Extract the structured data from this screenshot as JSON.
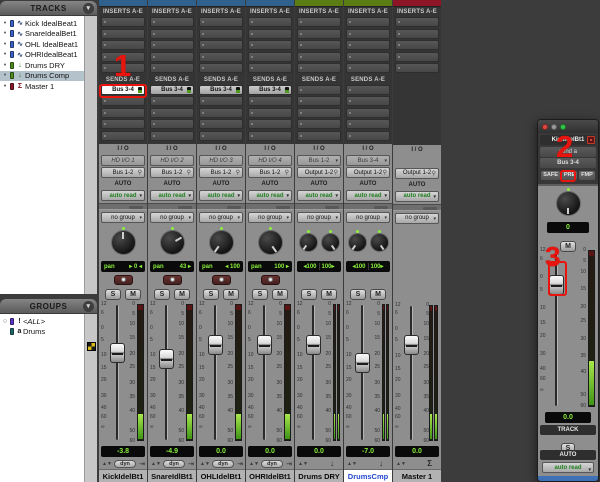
{
  "tracks_panel": {
    "title": "TRACKS",
    "tracks": [
      {
        "name": "Kick IdealBeat1",
        "chip": "#3a62c8",
        "type_icon": "waveform",
        "glyph": "∿",
        "icon_color": "#23406e",
        "selected": false
      },
      {
        "name": "SnareIdealBet1",
        "chip": "#3a62c8",
        "type_icon": "waveform",
        "glyph": "∿",
        "icon_color": "#23406e",
        "selected": false
      },
      {
        "name": "OHL IdealBeat1",
        "chip": "#3a62c8",
        "type_icon": "waveform",
        "glyph": "∿",
        "icon_color": "#23406e",
        "selected": false
      },
      {
        "name": "OHRIdealBeat1",
        "chip": "#3a62c8",
        "type_icon": "waveform",
        "glyph": "∿",
        "icon_color": "#23406e",
        "selected": false
      },
      {
        "name": "Drums DRY",
        "chip": "#4e8a1e",
        "type_icon": "aux-arrow",
        "glyph": "↓",
        "icon_color": "#2e6a10",
        "selected": false
      },
      {
        "name": "Drums Comp",
        "chip": "#4e8a1e",
        "type_icon": "aux-arrow",
        "glyph": "↓",
        "icon_color": "#2e6a10",
        "selected": true
      },
      {
        "name": "Master 1",
        "chip": "#8a1a28",
        "type_icon": "sigma",
        "glyph": "Σ",
        "icon_color": "#7a1220",
        "selected": false
      }
    ]
  },
  "groups_panel": {
    "title": "GROUPS",
    "groups": [
      {
        "mark": "○",
        "chip": "#5a35c8",
        "id": "!",
        "name": "<ALL>"
      },
      {
        "mark": "",
        "chip": "#1e6a6a",
        "id": "a",
        "name": "Drums"
      }
    ]
  },
  "mixer": {
    "labels": {
      "inserts": "INSERTS A-E",
      "sends": "SENDS A-E",
      "io": "I / O",
      "auto": "AUTO"
    },
    "fader_scale": [
      "12",
      "6",
      "0",
      "5",
      "10",
      "15",
      "20",
      "30",
      "40",
      "60",
      "∞"
    ],
    "meter_scale": [
      "0",
      "5",
      "10",
      "15",
      "20",
      "25",
      "30",
      "35",
      "40",
      "50",
      "60"
    ],
    "strips": [
      {
        "name": "KickIdelBt1",
        "top_color": "#30608c",
        "sends_section": true,
        "send1": "Bus 3-4",
        "send1_active": true,
        "input": "HD I/O 1",
        "input_italic": true,
        "output": "Bus 1-2",
        "automation": "auto read",
        "group": "no group",
        "pan": [
          "pan",
          "▸ 0 ◂"
        ],
        "pan_stereo": false,
        "knobs": [
          0
        ],
        "record": true,
        "solo": "S",
        "mute": "M",
        "volume": "-3.8",
        "fader_frac": 0.29,
        "mode": "dyn",
        "mode_extra": "⇥",
        "meter": "mono",
        "selected": false
      },
      {
        "name": "SnareIdlBt1",
        "top_color": "#30608c",
        "sends_section": true,
        "send1": "Bus 3-4",
        "send1_active": false,
        "input": "HD I/O 2",
        "input_italic": true,
        "output": "Bus 1-2",
        "automation": "auto read",
        "group": "no group",
        "pan": [
          "pan",
          "43 ▸"
        ],
        "pan_stereo": false,
        "knobs": [
          60
        ],
        "record": true,
        "solo": "S",
        "mute": "M",
        "volume": "-4.9",
        "fader_frac": 0.33,
        "mode": "dyn",
        "mode_extra": "⇥",
        "meter": "mono",
        "selected": false
      },
      {
        "name": "OHLIdelBt1",
        "top_color": "#30608c",
        "sends_section": true,
        "send1": "Bus 3-4",
        "send1_active": false,
        "input": "HD I/O 3",
        "input_italic": true,
        "output": "Bus 1-2",
        "automation": "auto read",
        "group": "no group",
        "pan": [
          "pan",
          "◂ 100"
        ],
        "pan_stereo": false,
        "knobs": [
          -145
        ],
        "record": true,
        "solo": "S",
        "mute": "M",
        "volume": "0.0",
        "fader_frac": 0.23,
        "mode": "dyn",
        "mode_extra": "⇥",
        "meter": "mono",
        "selected": false
      },
      {
        "name": "OHRIdelBt1",
        "top_color": "#30608c",
        "sends_section": true,
        "send1": "Bus 3-4",
        "send1_active": false,
        "input": "HD I/O 4",
        "input_italic": true,
        "output": "Bus 1-2",
        "automation": "auto read",
        "group": "no group",
        "pan": [
          "pan",
          "100 ▸"
        ],
        "pan_stereo": false,
        "knobs": [
          145
        ],
        "record": true,
        "solo": "S",
        "mute": "M",
        "volume": "0.0",
        "fader_frac": 0.23,
        "mode": "dyn",
        "mode_extra": "⇥",
        "meter": "mono",
        "selected": false
      },
      {
        "name": "Drums DRY",
        "top_color": "#5c7c14",
        "sends_section": true,
        "send1": null,
        "send1_active": false,
        "input": "Bus 1-2",
        "input_italic": false,
        "output": "Output 1-2",
        "automation": "auto read",
        "group": "no group",
        "pan": [
          "◂100",
          "100▸"
        ],
        "pan_stereo": true,
        "knobs": [
          -145,
          145
        ],
        "record": false,
        "solo": "S",
        "mute": "M",
        "volume": "0.0",
        "fader_frac": 0.23,
        "mode": "arrow",
        "mode_label": "↓",
        "meter": "stereo",
        "selected": false
      },
      {
        "name": "DrumsCmp",
        "top_color": "#5c7c14",
        "sends_section": true,
        "send1": null,
        "send1_active": false,
        "input": "Bus 3-4",
        "input_italic": false,
        "output": "Output 1-2",
        "automation": "auto read",
        "group": "no group",
        "pan": [
          "◂100",
          "100▸"
        ],
        "pan_stereo": true,
        "knobs": [
          -145,
          145
        ],
        "record": false,
        "solo": "S",
        "mute": "M",
        "volume": "-7.0",
        "fader_frac": 0.36,
        "mode": "arrow",
        "mode_label": "↓",
        "meter": "stereo",
        "selected": true
      },
      {
        "name": "Master 1",
        "top_color": "#8c1626",
        "sends_section": false,
        "send1": null,
        "send1_active": false,
        "input": null,
        "input_italic": false,
        "output": "Output 1-2",
        "automation": "auto read",
        "group": "no group",
        "pan": null,
        "pan_stereo": false,
        "knobs": [],
        "record": false,
        "solo": null,
        "mute": null,
        "volume": "0.0",
        "fader_frac": 0.23,
        "mode": "sigma",
        "mode_label": "Σ",
        "meter": "master",
        "selected": false
      }
    ]
  },
  "float_window": {
    "traffic_lights": [
      "#e0453f",
      "#9a9a9a",
      "#31c749"
    ],
    "track_name": "KickIdelBt1",
    "send_slot": "send a",
    "bus": "Bus 3-4",
    "safe": "SAFE",
    "pre": "PRE",
    "fmp": "FMP",
    "level": "0",
    "mute": "M",
    "volume": "0.0",
    "track_label": "TRACK",
    "solo": "S",
    "auto_label": "AUTO",
    "automation": "auto read",
    "fader_frac": 0.17
  },
  "annotations": {
    "n1": "1",
    "n2": "2",
    "n3": "3"
  },
  "colors": {
    "annotation_red": "#e8150f",
    "selected_name_blue": "#2547d0",
    "meter_green": "#54c01e",
    "auto_green": "#1d7e1d",
    "value_green": "#8af03c"
  }
}
